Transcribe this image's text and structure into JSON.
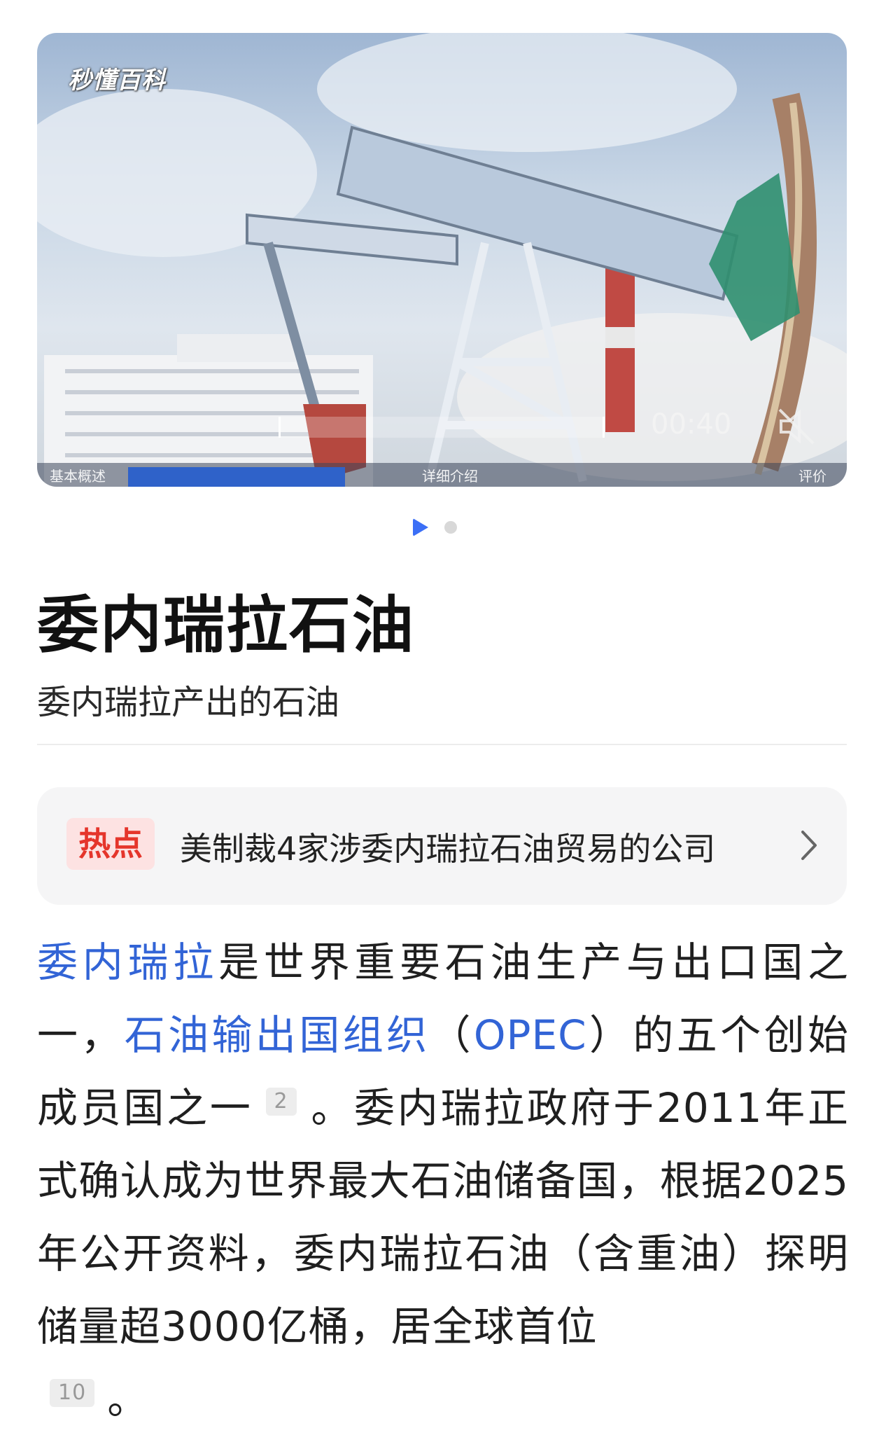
{
  "media": {
    "logo": "秒懂百科",
    "duration": "00:40",
    "tabs": [
      "基本概述",
      "详细介绍",
      "评价"
    ],
    "page_indicator": {
      "current": 1,
      "total": 2
    }
  },
  "entry": {
    "title": "委内瑞拉石油",
    "subtitle": "委内瑞拉产出的石油"
  },
  "hot": {
    "badge": "热点",
    "text": "美制裁4家涉委内瑞拉石油贸易的公司"
  },
  "paragraph": {
    "link_venezuela": "委内瑞拉",
    "seg1": "是世界重要石油生产与出口国之一，",
    "link_opec": "石油输出国组织",
    "paren_open": "（",
    "link_opec_abbr": "OPEC",
    "seg2": "）的五个创始成员国之一",
    "ref1": "2",
    "seg3": "。委内瑞拉政府于2011年正式确认成为世界最大石油储备国，根据2025年公开资料，委内瑞拉石油（含重油）探明储量超3000亿桶，居全球首位",
    "ref2": "10",
    "seg4": "。"
  },
  "colors": {
    "link": "#3264d6",
    "hot_badge_text": "#e5352b",
    "hot_badge_bg": "#fde2e2",
    "indicator_active": "#3b6ff6"
  }
}
